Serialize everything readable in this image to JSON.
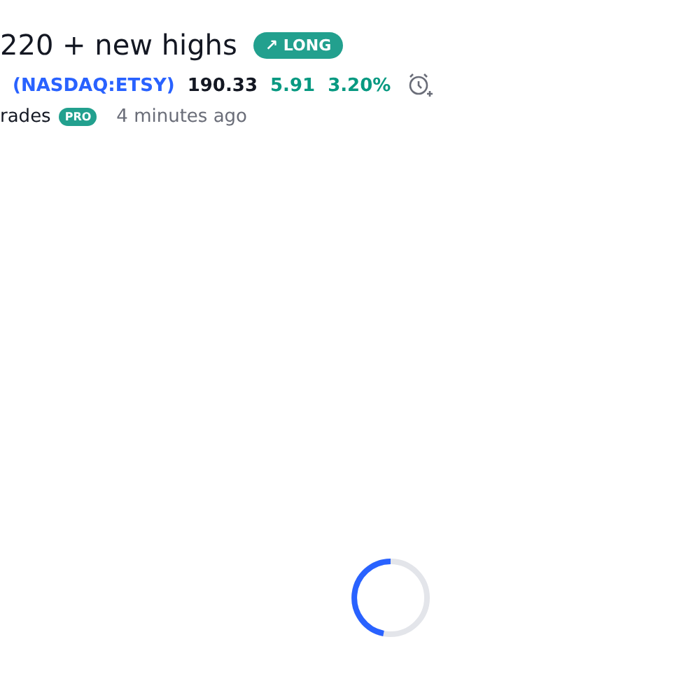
{
  "idea": {
    "title": "220 + new highs",
    "direction_badge": {
      "icon": "↗",
      "label": "LONG"
    },
    "symbol": "(NASDAQ:ETSY)",
    "price": "190.33",
    "change": "5.91",
    "change_percent": "3.20%",
    "author": "rades",
    "author_badge": "PRO",
    "time": "4 minutes ago"
  },
  "loading": true
}
